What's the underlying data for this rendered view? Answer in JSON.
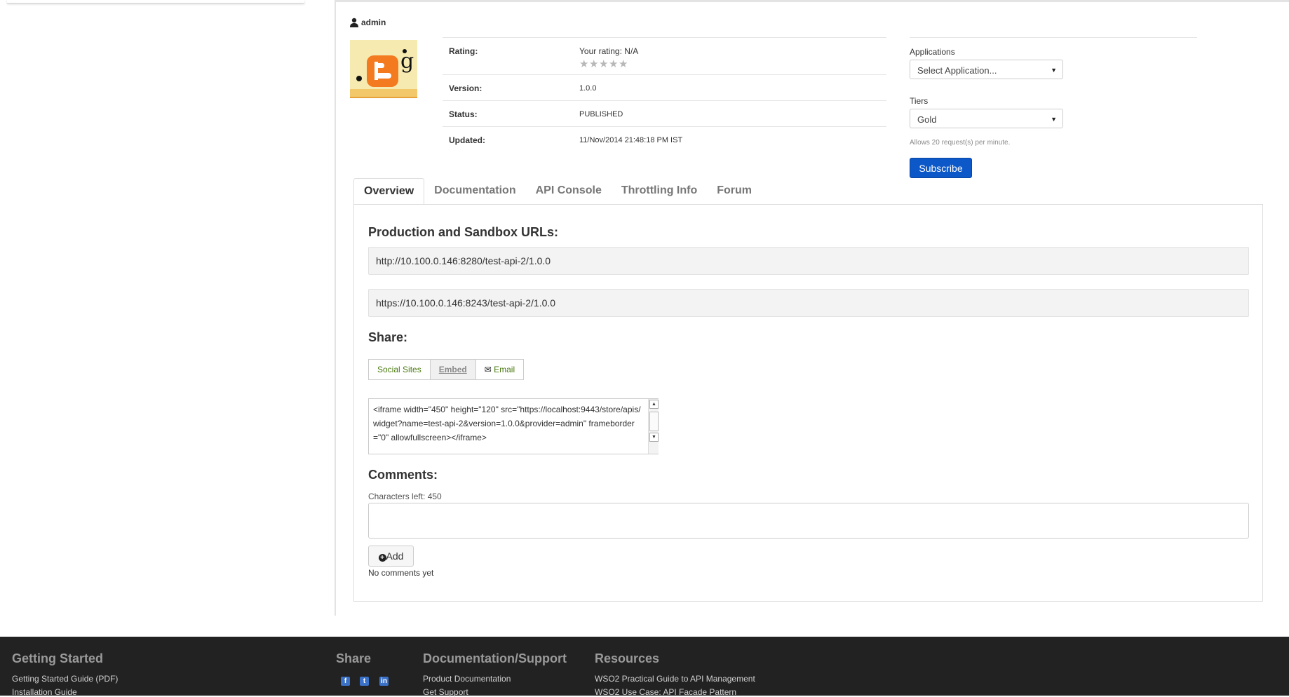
{
  "owner": {
    "name": "admin"
  },
  "api_info": {
    "rating_label": "Rating:",
    "your_rating_label": "Your rating:",
    "your_rating_value": "N/A",
    "stars_max": 5,
    "stars_filled": 0,
    "version_label": "Version:",
    "version_value": "1.0.0",
    "status_label": "Status:",
    "status_value": "PUBLISHED",
    "updated_label": "Updated:",
    "updated_value": "11/Nov/2014 21:48:18 PM IST"
  },
  "subscription": {
    "applications_label": "Applications",
    "application_selected": "Select Application...",
    "tiers_label": "Tiers",
    "tier_selected": "Gold",
    "tier_note": "Allows 20 request(s) per minute.",
    "subscribe_label": "Subscribe",
    "accent_color": "#0d58c8"
  },
  "tabs": [
    {
      "label": "Overview",
      "active": true
    },
    {
      "label": "Documentation",
      "active": false
    },
    {
      "label": "API Console",
      "active": false
    },
    {
      "label": "Throttling Info",
      "active": false
    },
    {
      "label": "Forum",
      "active": false
    }
  ],
  "overview": {
    "urls_heading": "Production and Sandbox URLs:",
    "urls": [
      "http://10.100.0.146:8280/test-api-2/1.0.0",
      "https://10.100.0.146:8243/test-api-2/1.0.0"
    ],
    "share_heading": "Share:",
    "share_tabs": {
      "social": "Social Sites",
      "embed": "Embed",
      "email": "Email"
    },
    "embed_code": "<iframe width=\"450\" height=\"120\" src=\"https://localhost:9443/store/apis/widget?name=test-api-2&version=1.0.0&provider=admin\" frameborder=\"0\" allowfullscreen></iframe>",
    "comments_heading": "Comments:",
    "chars_left": "Characters left: 450",
    "add_label": "Add",
    "no_comments": "No comments yet"
  },
  "footer": {
    "getting_started": {
      "title": "Getting Started",
      "links": [
        "Getting Started Guide (PDF)",
        "Installation Guide"
      ]
    },
    "share": {
      "title": "Share",
      "icons": [
        "facebook-icon",
        "twitter-icon",
        "linkedin-icon"
      ]
    },
    "docs": {
      "title": "Documentation/Support",
      "links": [
        "Product Documentation",
        "Get Support"
      ]
    },
    "resources": {
      "title": "Resources",
      "links": [
        "WSO2 Practical Guide to API Management",
        "WSO2 Use Case: API Facade Pattern"
      ]
    }
  }
}
